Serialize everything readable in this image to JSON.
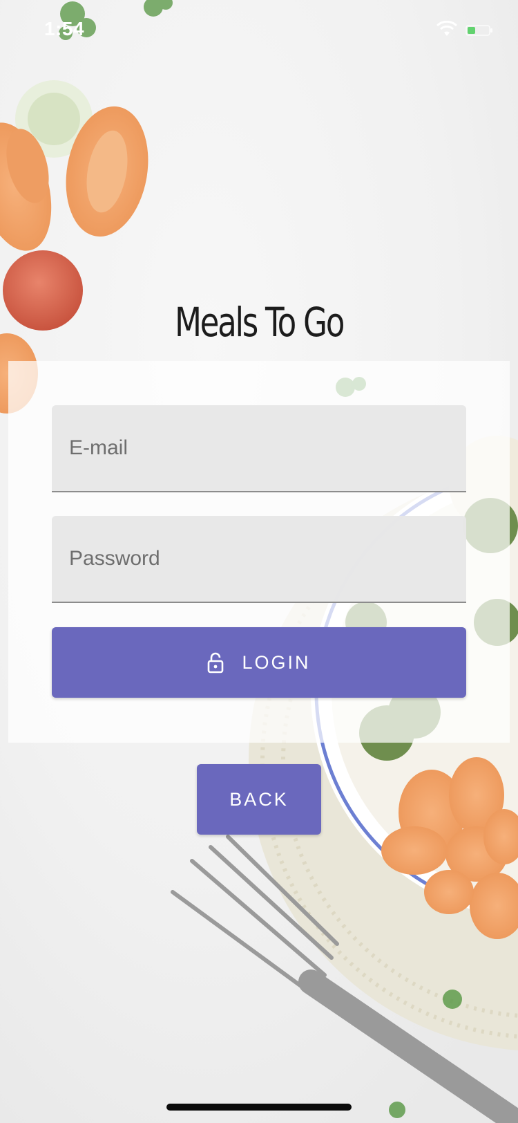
{
  "status_bar": {
    "time": "1:54",
    "wifi_icon": "wifi-icon",
    "battery_icon": "battery-icon",
    "battery_color": "#62d26f"
  },
  "app": {
    "title": "Meals To Go"
  },
  "form": {
    "email_placeholder": "E-mail",
    "password_placeholder": "Password",
    "login_label": "LOGIN",
    "login_icon": "lock-open-icon"
  },
  "back_label": "BACK",
  "colors": {
    "accent": "#6a68bd",
    "field_bg": "#e7e7e7",
    "title_text": "#1c1c1c"
  }
}
